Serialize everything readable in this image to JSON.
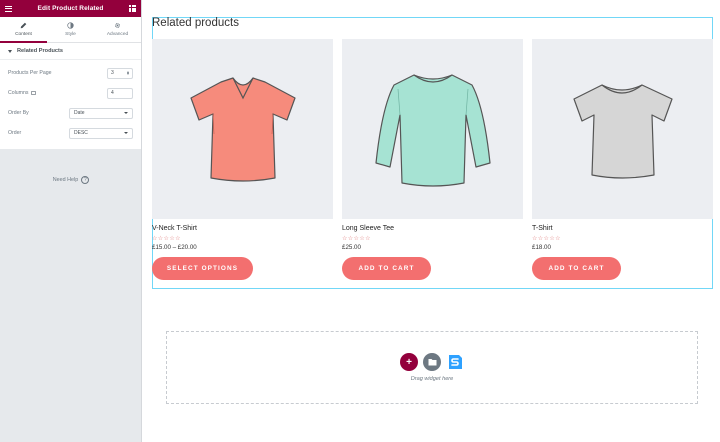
{
  "panel": {
    "title": "Edit Product Related",
    "tabs": [
      {
        "label": "Content",
        "icon": "pencil-icon",
        "active": true
      },
      {
        "label": "Style",
        "icon": "contrast-icon",
        "active": false
      },
      {
        "label": "Advanced",
        "icon": "gear-icon",
        "active": false
      }
    ],
    "section_title": "Related Products",
    "controls": {
      "per_page": {
        "label": "Products Per Page",
        "value": "3"
      },
      "columns": {
        "label": "Columns",
        "value": "4"
      },
      "order_by": {
        "label": "Order By",
        "value": "Date"
      },
      "order": {
        "label": "Order",
        "value": "DESC"
      }
    },
    "need_help": "Need Help",
    "accent": "#93003c"
  },
  "canvas": {
    "heading": "Related products",
    "products": [
      {
        "name": "V-Neck T-Shirt",
        "stars": "☆☆☆☆☆",
        "price": "£15.00 – £20.00",
        "button": "SELECT OPTIONS",
        "shirt_color": "#f68b7c"
      },
      {
        "name": "Long Sleeve Tee",
        "stars": "☆☆☆☆☆",
        "price": "£25.00",
        "button": "ADD TO CART",
        "shirt_color": "#a6e3d3"
      },
      {
        "name": "T-Shirt",
        "stars": "☆☆☆☆☆",
        "price": "£18.00",
        "button": "ADD TO CART",
        "shirt_color": "#d6d6d6"
      }
    ],
    "button_color": "#f36f6f",
    "dropzone_text": "Drag widget here"
  }
}
